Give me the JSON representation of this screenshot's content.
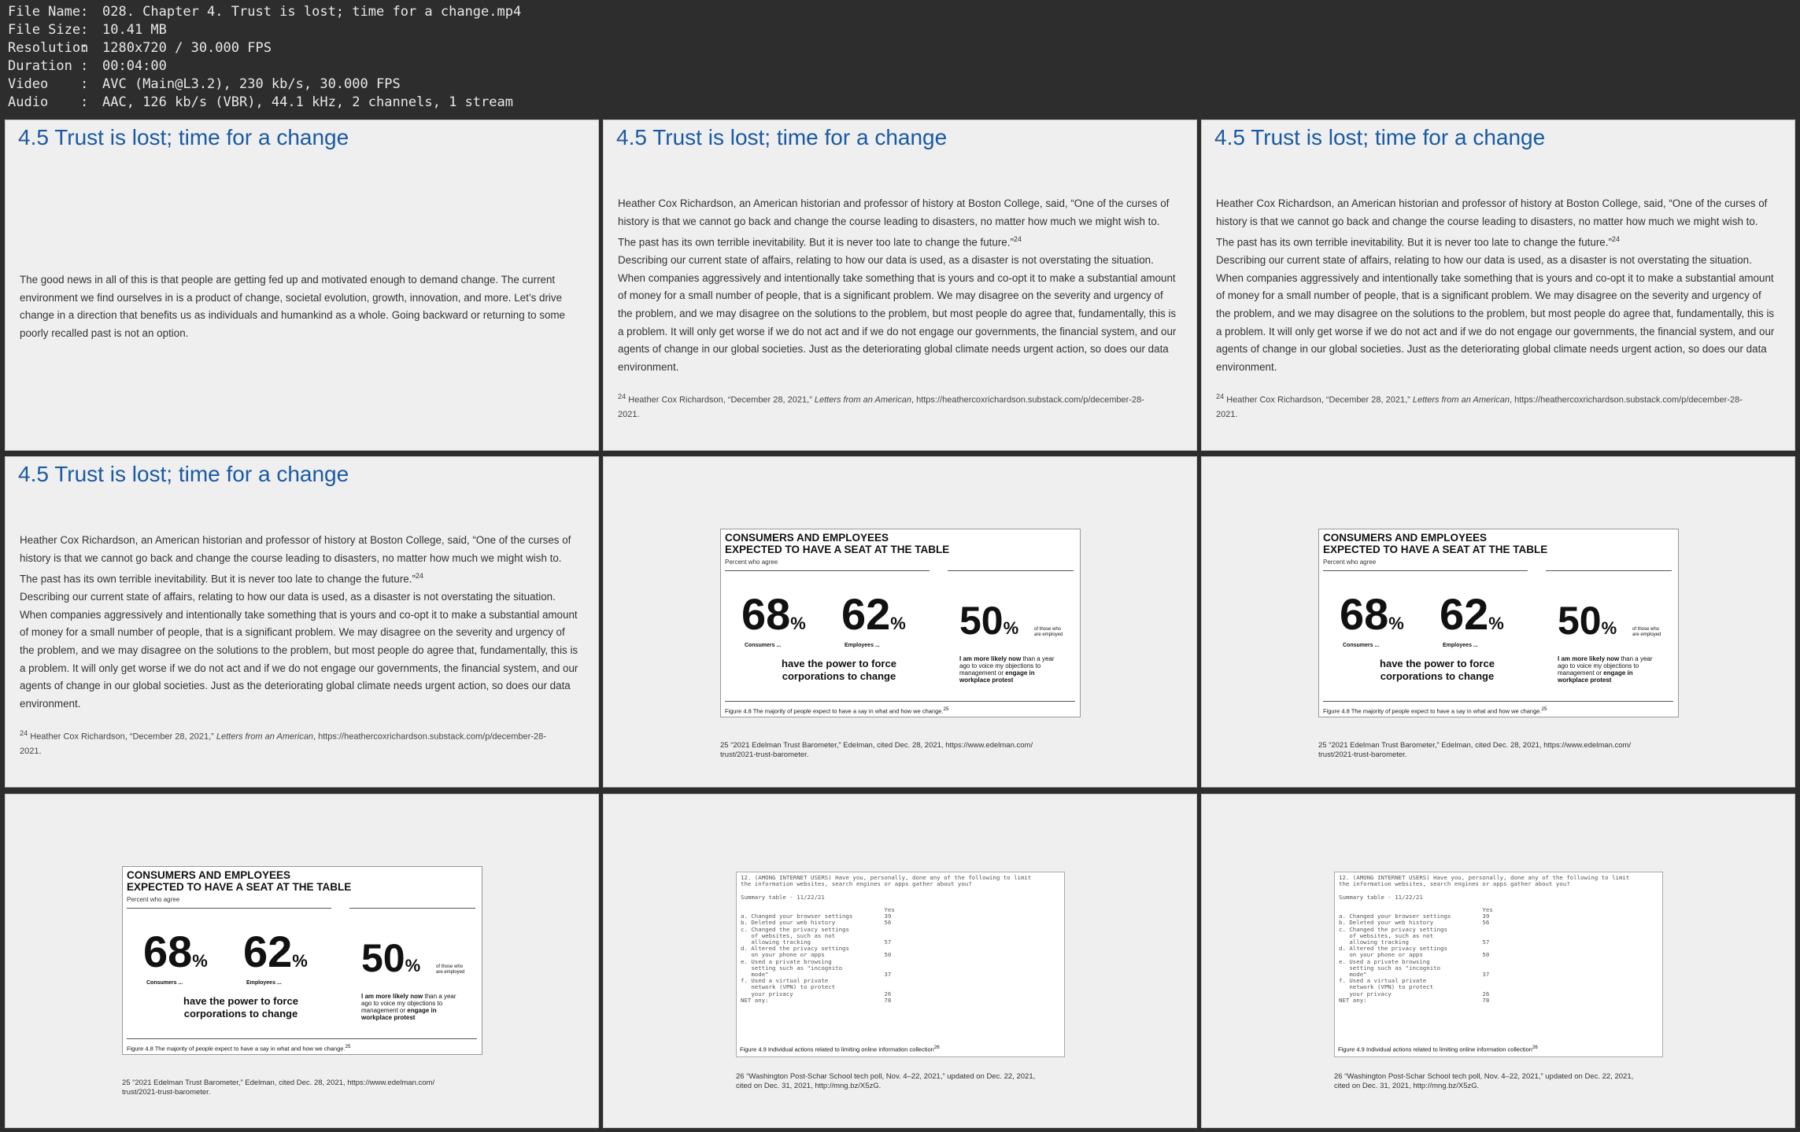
{
  "meta": [
    {
      "key": "File Name",
      "value": "028. Chapter 4. Trust is lost; time for a change.mp4"
    },
    {
      "key": "File Size",
      "value": "10.41 MB"
    },
    {
      "key": "Resolution",
      "value": "1280x720 / 30.000 FPS"
    },
    {
      "key": "Duration",
      "value": "00:04:00"
    },
    {
      "key": "Video",
      "value": "AVC (Main@L3.2), 230 kb/s, 30.000 FPS"
    },
    {
      "key": "Audio",
      "value": "AAC, 126 kb/s (VBR), 44.1 kHz, 2 channels, 1 stream"
    }
  ],
  "meta_colon": ":",
  "slide_title": "4.5 Trust is lost; time for a change",
  "good_news": "The good news in all of this is that people are getting fed up and motivated enough to demand change. The current environment we find ourselves in is a product of change, societal evolution, growth, innovation, and more. Let’s drive change in a direction that benefits us as individuals and humankind as a whole. Going backward or returning to some poorly recalled past is not an option.",
  "quote_text": "Heather Cox Richardson, an American historian and professor of history at Boston College, said, “One of the curses of history is that we cannot go back and change the course leading to disasters, no matter how much we might wish to. The past has its own terrible inevitability. But it is never too late to change the future.”",
  "quote_sup": "24",
  "describing_text": "Describing our current state of affairs, relating to how our data is used, as a disaster is not overstating the situation. When companies aggressively and intentionally take something that is yours and co-opt it to make a substantial amount of money for a small number of people, that is a significant problem. We may disagree on the severity and urgency of the problem, and we may disagree on the solutions to the problem, but most people do agree that, fundamentally, this is a problem. It will only get worse if we do not act and if we do not engage our governments, the financial system, and our agents of change in our global societies. Just as the deteriorating global climate needs urgent action, so does our data environment.",
  "footnote24": {
    "num": "24",
    "author": "Heather Cox Richardson, “December 28, 2021,” ",
    "work": "Letters from an American",
    "url": ", https://heathercoxrichardson.substack.com/p/december-28-",
    "tail": "2021."
  },
  "figure48": {
    "heading_1": "CONSUMERS AND EMPLOYEES",
    "heading_2": "EXPECTED TO HAVE A SEAT AT THE TABLE",
    "subheading": "Percent who agree",
    "stat1": "68",
    "stat1_label": "Consumers ...",
    "stat2": "62",
    "stat2_label": "Employees ...",
    "percent": "%",
    "middle_text_1": "have the power to force",
    "middle_text_2": "corporations to change",
    "stat3": "50",
    "stat3_note_1": "of those who",
    "stat3_note_2": "are employed",
    "right_b1": "I am more likely now",
    "right_t1": " than a year",
    "right_t2": "ago to voice my objections to",
    "right_t3": "management or ",
    "right_b2": "engage in",
    "right_b3": "workplace protest",
    "caption": "Figure 4.8 The majority of people expect to have a say in what and how we change.",
    "caption_sup": "25"
  },
  "footnote25": {
    "line1": "25 “2021 Edelman Trust Barometer,” Edelman, cited Dec. 28, 2021, https://www.edelman.com/",
    "line2": "trust/2021-trust-barometer."
  },
  "figure49": {
    "poll_text": "12. (AMONG INTERNET USERS) Have you, personally, done any of the following to limit\nthe information websites, search engines or apps gather about you?\n\nSummary table - 11/22/21\n\n                                         Yes\na. Changed your browser settings         39\nb. Deleted your web history              56\nc. Changed the privacy settings\n   of websites, such as not\n   allowing tracking                     57\nd. Altered the privacy settings\n   on your phone or apps                 50\ne. Used a private browsing\n   setting such as \"incognito\n   mode\"                                 37\nf. Used a virtual private\n   network (VPN) to protect\n   your privacy                          26\nNET any:                                 78",
    "caption": "Figure 4.9 Individual actions related to limiting online information collection",
    "caption_sup": "26"
  },
  "footnote26": {
    "line1": "26 “Washington Post-Schar School tech poll, Nov. 4–22, 2021,” updated on Dec. 22, 2021,",
    "line2": "cited on Dec. 31, 2021, http://mng.bz/X5zG."
  }
}
